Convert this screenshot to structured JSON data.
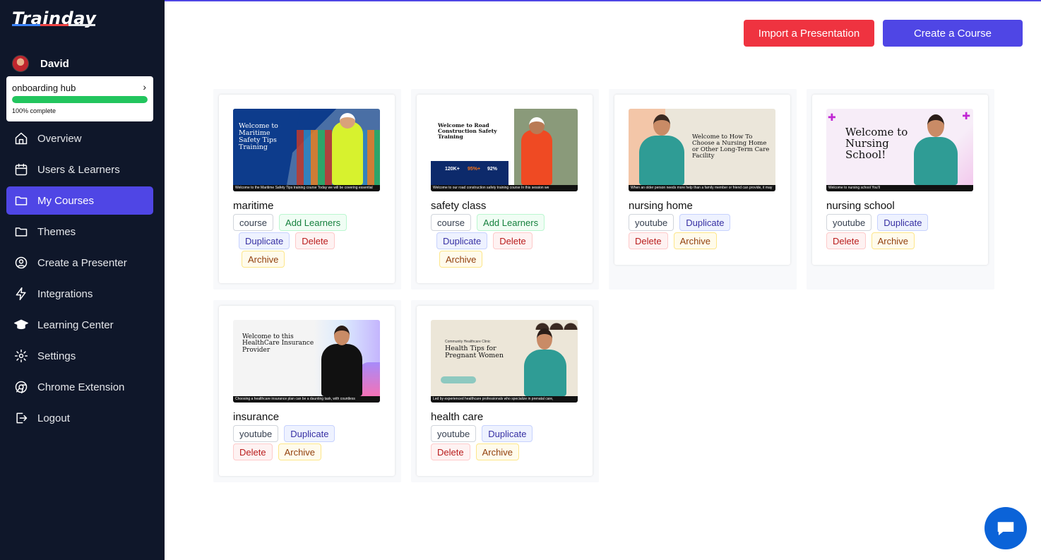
{
  "app": {
    "logo": "Trainday",
    "brand_colors": {
      "primary": "#4f46e5",
      "danger": "#ef3340",
      "success": "#22c55e",
      "sidebar": "#0f172a"
    }
  },
  "user": {
    "name": "David"
  },
  "hub": {
    "title": "onboarding hub",
    "progress_text": "100% complete",
    "progress": 1.0
  },
  "nav": [
    {
      "label": "Overview",
      "icon": "home-icon"
    },
    {
      "label": "Users & Learners",
      "icon": "calendar-icon"
    },
    {
      "label": "My Courses",
      "icon": "folder-icon",
      "active": true
    },
    {
      "label": "Themes",
      "icon": "folder-icon"
    },
    {
      "label": "Create a Presenter",
      "icon": "user-circle-icon"
    },
    {
      "label": "Integrations",
      "icon": "bolt-icon"
    },
    {
      "label": "Learning Center",
      "icon": "graduation-cap-icon"
    },
    {
      "label": "Settings",
      "icon": "gear-icon"
    },
    {
      "label": "Chrome Extension",
      "icon": "chrome-icon"
    },
    {
      "label": "Logout",
      "icon": "logout-icon"
    }
  ],
  "actions": {
    "import": "Import a Presentation",
    "create": "Create a Course"
  },
  "courses": [
    {
      "title": "maritime",
      "type": "course",
      "buttons": [
        "Add Learners",
        "Duplicate",
        "Delete",
        "Archive"
      ],
      "thumb": {
        "text": "Welcome to Maritime Safety Tips Training",
        "caption": "Welcome to the Maritime Safety Tips training course Today we will be covering essential"
      }
    },
    {
      "title": "safety class",
      "type": "course",
      "buttons": [
        "Add Learners",
        "Duplicate",
        "Delete",
        "Archive"
      ],
      "thumb": {
        "text": "Welcome to Road Construction Safety Training",
        "caption": "Welcome to our road construction safety training course In this session we",
        "stats": [
          "120K+",
          "95%+",
          "92%"
        ]
      }
    },
    {
      "title": "nursing home",
      "type": "youtube",
      "buttons": [
        "Duplicate",
        "Delete",
        "Archive"
      ],
      "thumb": {
        "text": "Welcome to How To Choose a Nursing Home or Other Long-Term Care Facility",
        "caption": "When an older person needs more help than a family member or friend can provide, it may"
      }
    },
    {
      "title": "nursing school",
      "type": "youtube",
      "buttons": [
        "Duplicate",
        "Delete",
        "Archive"
      ],
      "thumb": {
        "text": "Welcome to Nursing School!",
        "caption": "Welcome to nursing school You'll"
      }
    },
    {
      "title": "insurance",
      "type": "youtube",
      "buttons": [
        "Duplicate",
        "Delete",
        "Archive"
      ],
      "thumb": {
        "text": "Welcome to this HealthCare Insurance Provider",
        "caption": "Choosing a healthcare insurance plan can be a daunting task, with countless"
      }
    },
    {
      "title": "health care",
      "type": "youtube",
      "buttons": [
        "Duplicate",
        "Delete",
        "Archive"
      ],
      "thumb": {
        "text": "Health Tips for Pregnant Women",
        "subtext": "Community Healthcare Clinic",
        "caption": "Led by experienced healthcare professionals who specialize in prenatal care,"
      }
    }
  ]
}
